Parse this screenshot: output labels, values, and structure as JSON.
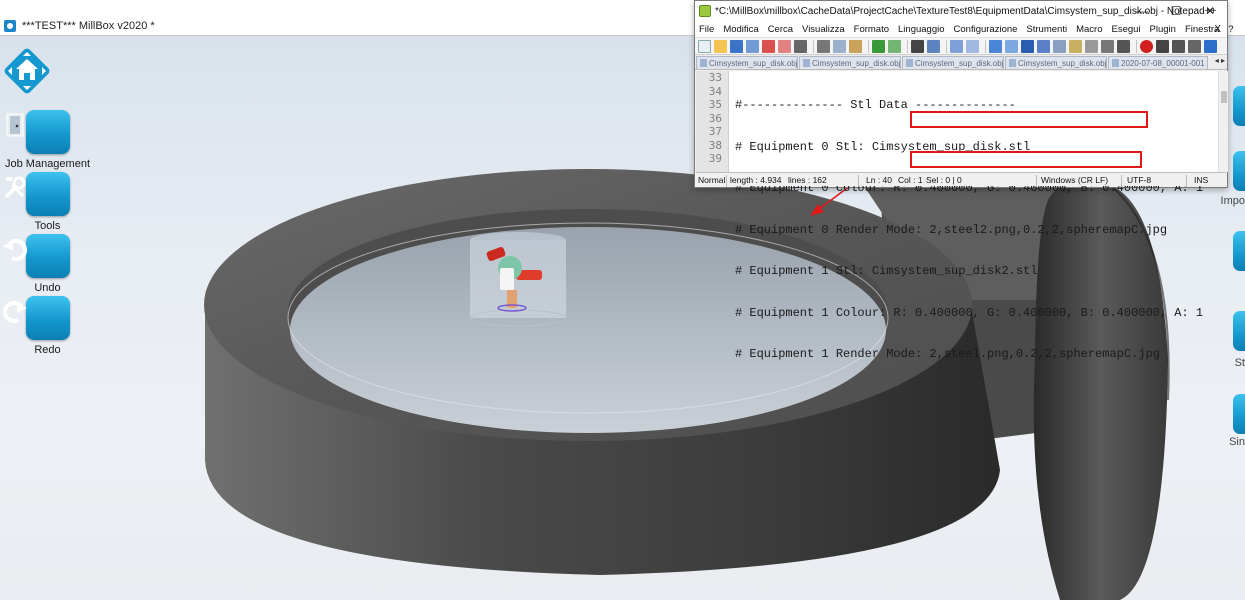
{
  "main_window": {
    "title": "***TEST*** MillBox v2020 *"
  },
  "left_toolbar": {
    "items": [
      {
        "label": "",
        "icon": "home-icon"
      },
      {
        "label": "Job Management",
        "icon": "door-icon"
      },
      {
        "label": "Tools",
        "icon": "tools-icon"
      },
      {
        "label": "Undo",
        "icon": "undo-icon"
      },
      {
        "label": "Redo",
        "icon": "redo-icon"
      }
    ]
  },
  "right_edge": {
    "labels": [
      "Impo",
      "St",
      "Sin"
    ]
  },
  "notepad": {
    "title": "*C:\\MillBox\\millbox\\CacheData\\ProjectCache\\TextureTest8\\EquipmentData\\Cimsystem_sup_disk.obj - Notepad++",
    "window_controls": {
      "minimize": "—",
      "maximize": "☐",
      "close": "✕"
    },
    "menu": [
      "File",
      "Modifica",
      "Cerca",
      "Visualizza",
      "Formato",
      "Linguaggio",
      "Configurazione",
      "Strumenti",
      "Macro",
      "Esegui",
      "Plugin",
      "Finestra",
      "?"
    ],
    "menu_close": "X",
    "tabs": [
      "Cimsystem_sup_disk.obj",
      "Cimsystem_sup_disk.obj",
      "Cimsystem_sup_disk.obj",
      "Cimsystem_sup_disk.obj",
      "2020-07-08_00001-001"
    ],
    "tab_arrows": "◂ ▸",
    "line_numbers": [
      "33",
      "34",
      "35",
      "36",
      "37",
      "38",
      "39"
    ],
    "lines": [
      "#-------------- Stl Data --------------",
      "# Equipment 0 Stl: Cimsystem_sup_disk.stl",
      "# Equipment 0 Colour: R: 0.400000, G: 0.400000, B: 0.400000, A: 1",
      "# Equipment 0 Render Mode: 2,steel2.png,0.2,2,spheremapC.jpg",
      "# Equipment 1 Stl: Cimsystem_sup_disk2.stl",
      "# Equipment 1 Colour: R: 0.400000, G: 0.400000, B: 0.400000, A: 1",
      "# Equipment 1 Render Mode: 2,steel.png,0.2,2,spheremapC.jpg"
    ],
    "status": {
      "mode": "Normal",
      "length": "length : 4.934",
      "lines": "lines : 162",
      "ln": "Ln : 40",
      "col": "Col : 1",
      "sel": "Sel : 0 | 0",
      "eol": "Windows (CR LF)",
      "encoding": "UTF-8",
      "ins": "INS"
    }
  },
  "colors": {
    "accent_blue": "#1498cf",
    "highlight_red": "#e01818",
    "steel": "#6e6e6e"
  }
}
